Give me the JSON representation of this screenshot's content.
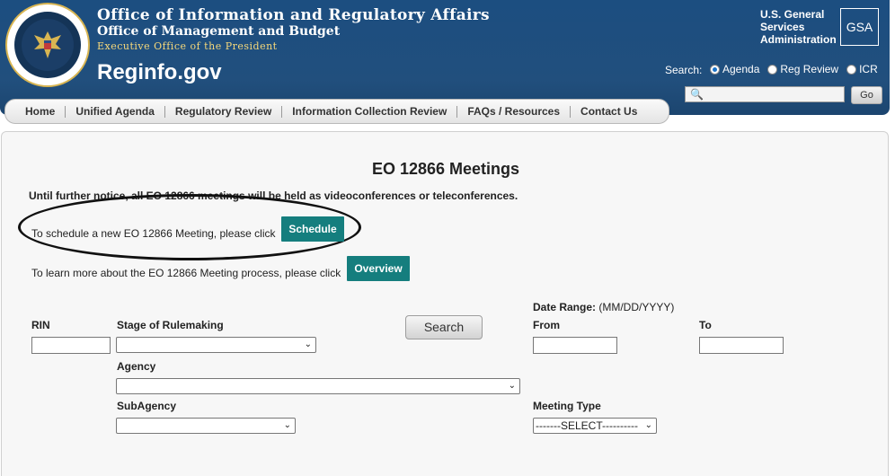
{
  "header": {
    "office_line1": "Office of Information and Regulatory Affairs",
    "office_line2": "Office of Management and Budget",
    "office_line3": "Executive Office of the President",
    "site_name": "Reginfo.gov",
    "gsa_line1": "U.S. General",
    "gsa_line2": "Services",
    "gsa_line3": "Administration",
    "gsa_logo": "GSA",
    "seal_icon": "presidential-seal-icon"
  },
  "search": {
    "label": "Search:",
    "options": [
      "Agenda",
      "Reg Review",
      "ICR"
    ],
    "selected": "Agenda",
    "value": "",
    "go_label": "Go"
  },
  "nav": {
    "items": [
      "Home",
      "Unified Agenda",
      "Regulatory Review",
      "Information Collection Review",
      "FAQs / Resources",
      "Contact Us"
    ]
  },
  "main": {
    "title": "EO 12866 Meetings",
    "notice": "Until further notice, all EO 12866 meetings will be held as videoconferences or teleconferences.",
    "schedule_text": "To schedule a new EO 12866 Meeting, please click",
    "schedule_button": "Schedule",
    "overview_text": "To learn more about the EO 12866 Meeting process, please click",
    "overview_button": "Overview"
  },
  "form": {
    "rin_label": "RIN",
    "stage_label": "Stage of Rulemaking",
    "date_range_label": "Date Range:",
    "date_range_hint": "(MM/DD/YYYY)",
    "from_label": "From",
    "to_label": "To",
    "agency_label": "Agency",
    "subagency_label": "SubAgency",
    "meeting_type_label": "Meeting Type",
    "meeting_type_value": "-------SELECT----------",
    "rin_value": "",
    "stage_value": "",
    "agency_value": "",
    "subagency_value": "",
    "from_value": "",
    "to_value": "",
    "search_button": "Search"
  }
}
